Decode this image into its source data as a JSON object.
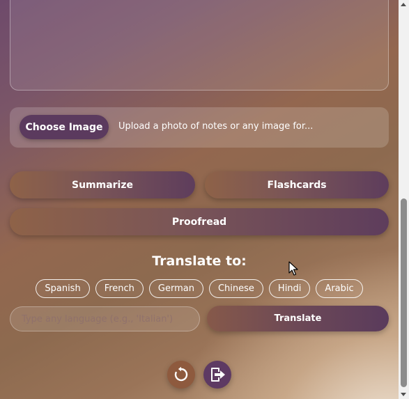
{
  "upload": {
    "choose_label": "Choose Image",
    "hint": "Upload a photo of notes or any image for..."
  },
  "actions": {
    "summarize": "Summarize",
    "flashcards": "Flashcards",
    "proofread": "Proofread"
  },
  "translate": {
    "heading": "Translate to:",
    "languages": [
      "Spanish",
      "French",
      "German",
      "Chinese",
      "Hindi",
      "Arabic"
    ],
    "input_placeholder": "Type any language (e.g., 'Italian')",
    "button_label": "Translate"
  },
  "icons": {
    "reset": "refresh-icon",
    "export": "export-icon"
  },
  "colors": {
    "button_dark": "#5b3a5e",
    "reset_button": "#8e5a3e",
    "export_button": "#5e3a63"
  }
}
